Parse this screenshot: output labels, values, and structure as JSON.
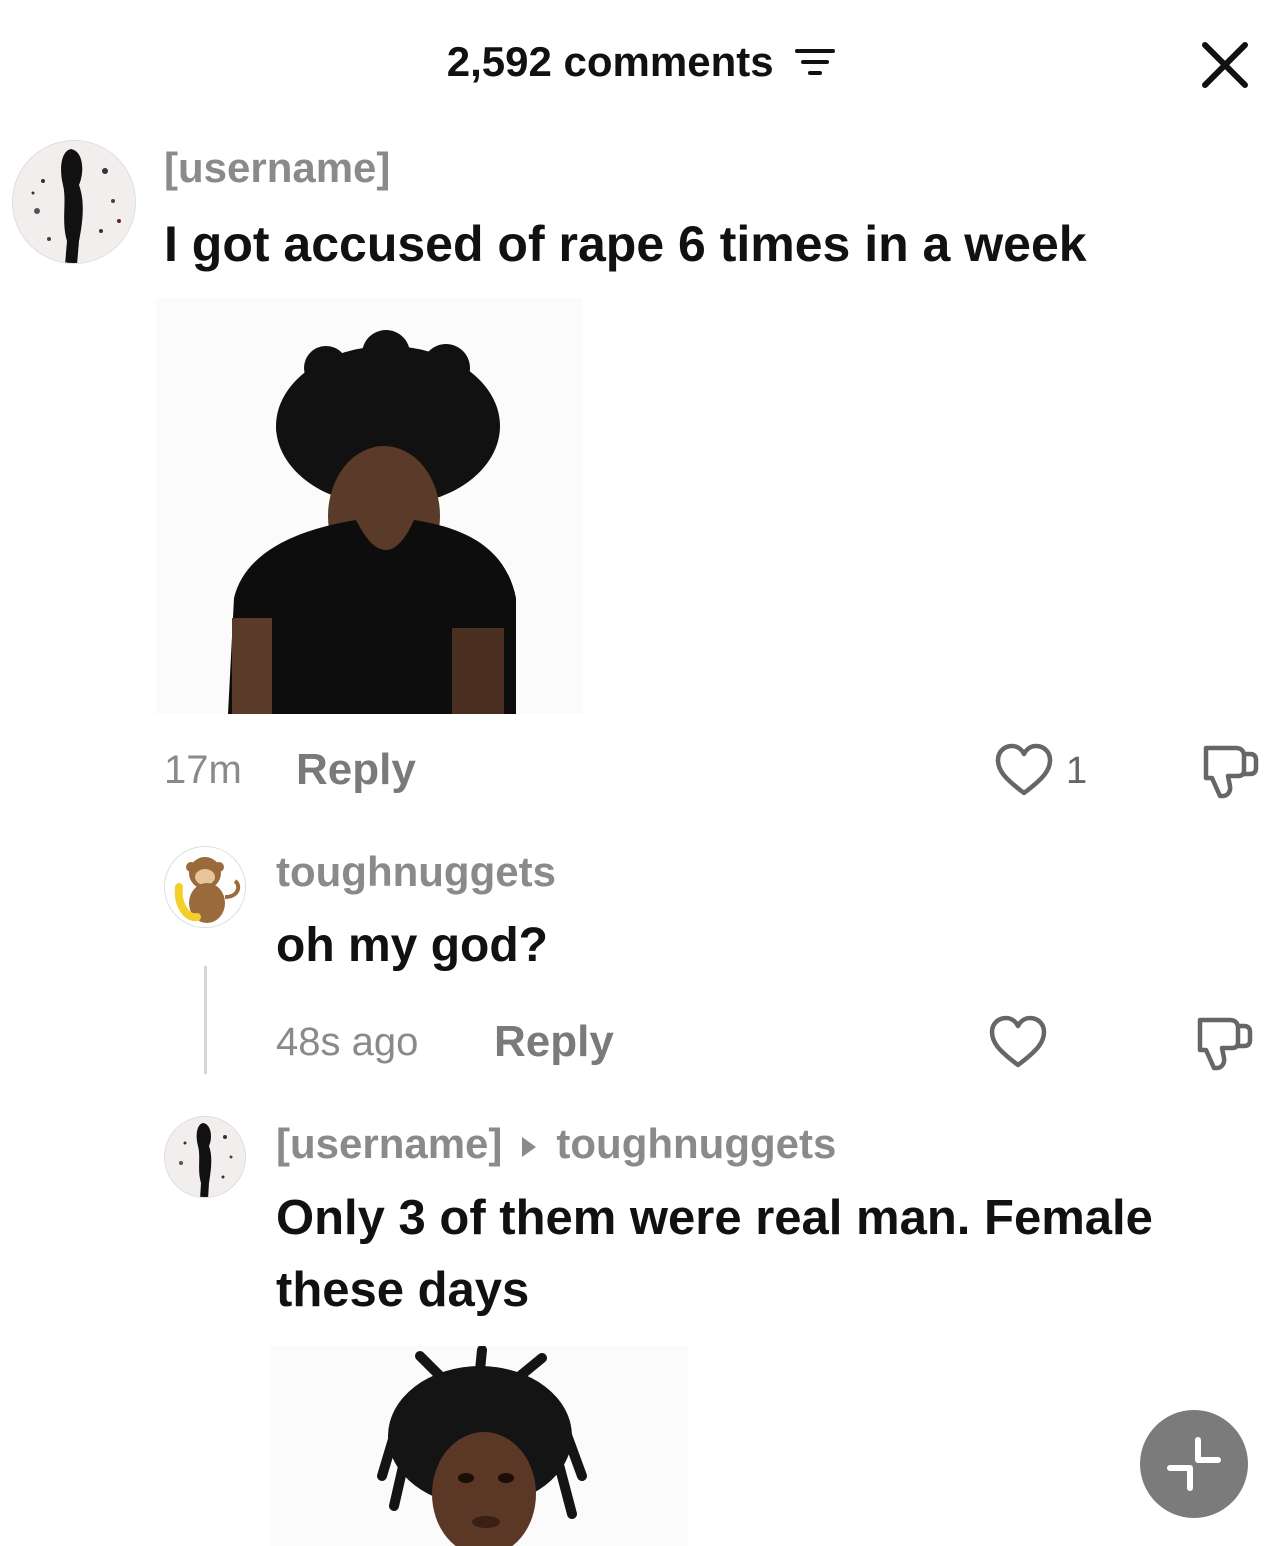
{
  "header": {
    "title": "2,592 comments",
    "filter_icon": "filter-lines-icon",
    "close_icon": "close-x-icon"
  },
  "comments": [
    {
      "username": "[username]",
      "text": "I got accused of rape 6 times in a week",
      "time": "17m",
      "reply_label": "Reply",
      "likes": "1",
      "has_media": true
    },
    {
      "username": "toughnuggets",
      "text": "oh my god?",
      "time": "48s ago",
      "reply_label": "Reply"
    },
    {
      "username": "[username]",
      "reply_to": "toughnuggets",
      "text_line1": "Only 3 of them were real man. Female",
      "text_line2": "these days",
      "has_media": true
    }
  ],
  "colors": {
    "primary_text": "#111111",
    "secondary_text": "#8a8a8a",
    "fab_bg": "#7b7b7b"
  }
}
